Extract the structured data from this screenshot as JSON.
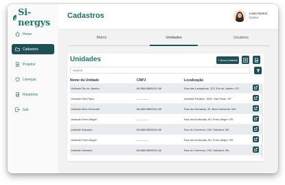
{
  "brand": {
    "logo_text": "Si-nergys",
    "accent": "#1f7a63",
    "dark": "#1f4f57"
  },
  "sidebar": {
    "items": [
      {
        "label": "Home",
        "icon": "home-icon",
        "active": false
      },
      {
        "label": "Cadastros",
        "icon": "folder-icon",
        "active": true
      },
      {
        "label": "Projetos",
        "icon": "document-icon",
        "active": false
      },
      {
        "label": "Licenças",
        "icon": "shield-icon",
        "active": false
      },
      {
        "label": "Relatórios",
        "icon": "report-icon",
        "active": false
      },
      {
        "label": "Sair",
        "icon": "logout-icon",
        "active": false
      }
    ]
  },
  "header": {
    "title": "Cadastros",
    "user": {
      "name": "Luisa Santos",
      "role": "Gestor"
    }
  },
  "tabs": [
    {
      "label": "Matriz",
      "active": false
    },
    {
      "label": "Unidades",
      "active": true
    },
    {
      "label": "Usuários",
      "active": false
    }
  ],
  "card": {
    "title": "Unidades",
    "new_button": "+ Nova Unidade",
    "search_placeholder": "Search",
    "columns": [
      "Nome da Unidade",
      "CNPJ",
      "Localização"
    ],
    "rows": [
      [
        "Unidade Rio de Janeiro",
        "88.888.888/0001-88",
        "Rua das Laranjeiras, 123, Rio de Janeiro, RJ"
      ],
      [
        "Unidade São Paulo",
        "-------------",
        "Avenida Paulista, 1500, São Paulo, SP"
      ],
      [
        "Unidade Belo Horizonte",
        "88.888.888/0001-88",
        "Rua da Liberdade, 45, Belo Horizonte, MG"
      ],
      [
        "Unidade Porto Alegre",
        "-------------",
        "Rua dos Andradas, 80, Porto Alegre, RS"
      ],
      [
        "Unidade Salvador",
        "88.888.888/0001-88",
        "Rua do Comércio, 200, Salvador, BA"
      ],
      [
        "Unidade Porto Alegre",
        "-------------",
        "Rua dos Andradas, 80, Porto Alegre, RS"
      ],
      [
        "Unidade Salvador",
        "88.888.888/0001-88",
        "Rua do Comércio, 200, Salvador, BA"
      ]
    ]
  }
}
